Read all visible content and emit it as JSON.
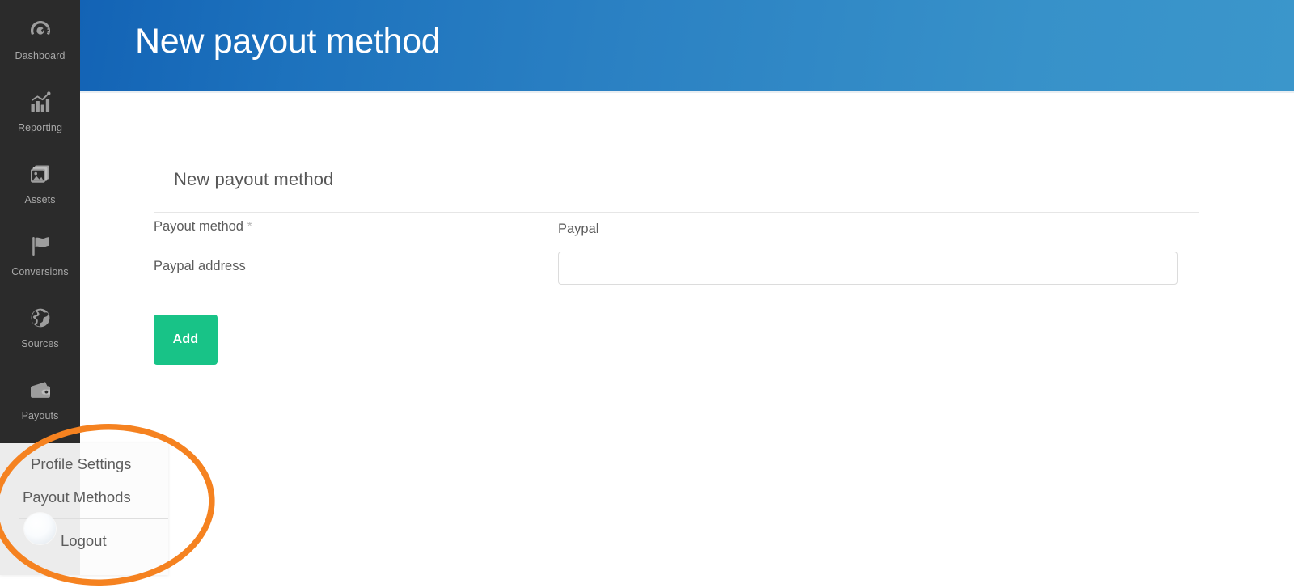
{
  "sidebar": {
    "items": [
      {
        "label": "Dashboard",
        "icon": "gauge-icon"
      },
      {
        "label": "Reporting",
        "icon": "bar-chart-icon"
      },
      {
        "label": "Assets",
        "icon": "image-stack-icon"
      },
      {
        "label": "Conversions",
        "icon": "flag-icon"
      },
      {
        "label": "Sources",
        "icon": "globe-icon"
      },
      {
        "label": "Payouts",
        "icon": "wallet-icon"
      }
    ],
    "background_color": "#2b2b2b",
    "label_color": "#a8a8a8"
  },
  "header": {
    "title": "New payout method",
    "gradient_start": "#1363b5",
    "gradient_end": "#3b96cb",
    "text_color": "#ffffff"
  },
  "main": {
    "section_title": "New payout method",
    "fields": [
      {
        "label": "Payout method",
        "required_marker": "*",
        "value": "Paypal",
        "type": "static-value"
      },
      {
        "label": "Paypal address",
        "required_marker": "",
        "value": "",
        "placeholder": "",
        "type": "text-input"
      }
    ],
    "submit_button": {
      "label": "Add",
      "color": "#18c387",
      "text_color": "#ffffff"
    }
  },
  "user_dropdown": {
    "visible": true,
    "background_color": "#ececec",
    "items": [
      {
        "label": "Profile Settings"
      },
      {
        "label": "Payout Methods"
      },
      {
        "label": "Logout"
      }
    ]
  },
  "annotation": {
    "shape": "ellipse",
    "color": "#f58220",
    "stroke_width": 7,
    "target": "user-dropdown"
  }
}
